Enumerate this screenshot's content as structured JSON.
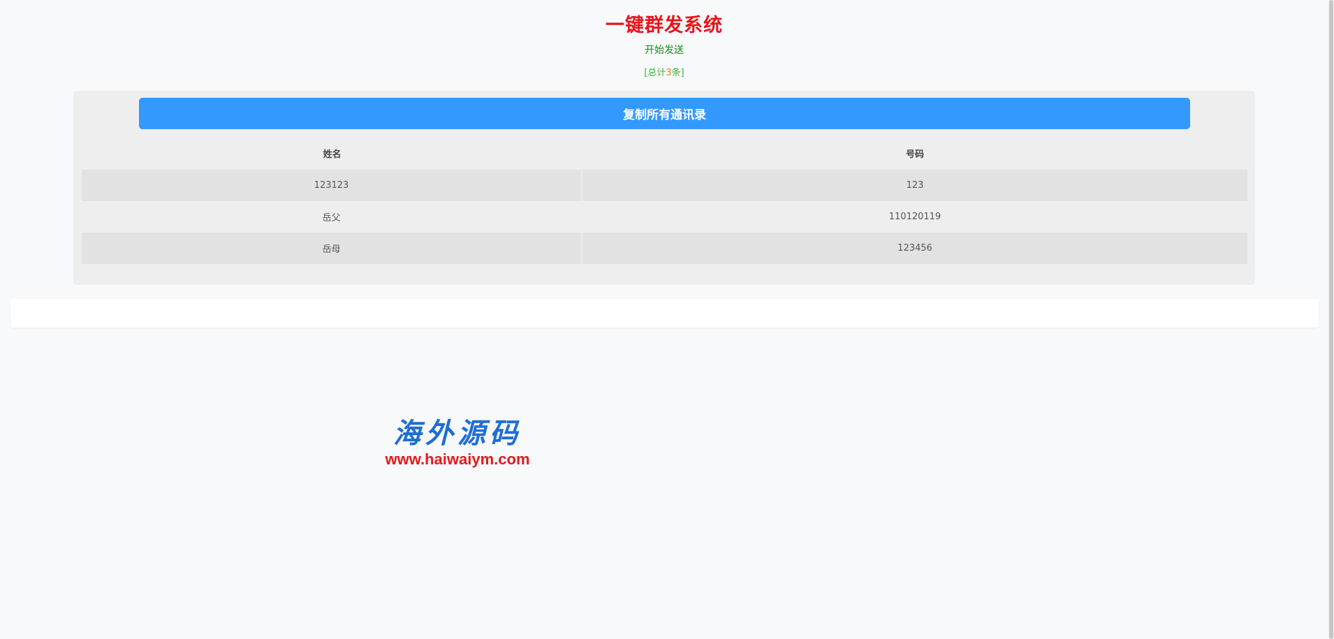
{
  "header": {
    "title": "一键群发系统",
    "start_send": "开始发送",
    "total_prefix": "[总计",
    "total_count": "3",
    "total_suffix": "条]"
  },
  "toolbar": {
    "copy_all_label": "复制所有通讯录"
  },
  "table": {
    "headers": [
      "姓名",
      "号码"
    ],
    "rows": [
      {
        "name": "123123",
        "number": "123"
      },
      {
        "name": "岳父",
        "number": "110120119"
      },
      {
        "name": "岳母",
        "number": "123456"
      }
    ]
  },
  "watermark": {
    "brand": "海外源码",
    "url": "www.haiwaiym.com"
  },
  "colors": {
    "title": "#e8141b",
    "start_send": "#1a8a1a",
    "button": "#3399ff",
    "watermark_brand": "#1f6ed4",
    "watermark_url": "#e31b1b"
  }
}
